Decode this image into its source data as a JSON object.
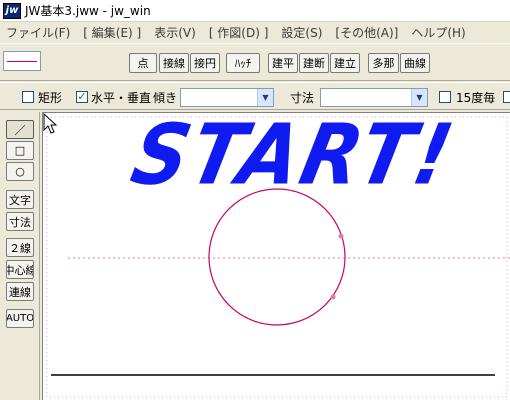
{
  "window": {
    "icon_label": "jw",
    "title": "JW基本3.jww - jw_win"
  },
  "menubar": {
    "items": [
      "ファイル(F)",
      "[ 編集(E) ]",
      "表示(V)",
      "[ 作図(D) ]",
      "設定(S)",
      "[その他(A)]",
      "ヘルプ(H)"
    ]
  },
  "toolbar": {
    "buttons": [
      "点",
      "接線",
      "接円",
      "ﾊｯﾁ",
      "建平",
      "建断",
      "建立",
      "多那",
      "曲線"
    ]
  },
  "options_bar": {
    "rectangle_label": "矩形",
    "rectangle_checked": false,
    "horizontal_vertical_label": "水平・垂直",
    "horizontal_vertical_checked": true,
    "tilt_label": "傾き",
    "tilt_value": "",
    "dimension_label": "寸法",
    "dimension_value": "",
    "fifteen_deg_label": "15度毎",
    "fifteen_deg_checked": false
  },
  "left_tools": [
    "／",
    "□",
    "○",
    "文字",
    "寸法",
    "２線",
    "中心線",
    "連線",
    "AUTO"
  ],
  "canvas": {
    "start_text": "START!",
    "colors": {
      "text": "#0f1bf0",
      "circle": "#cc0066",
      "guide": "#e07aa8",
      "baseline": "#000000"
    }
  }
}
